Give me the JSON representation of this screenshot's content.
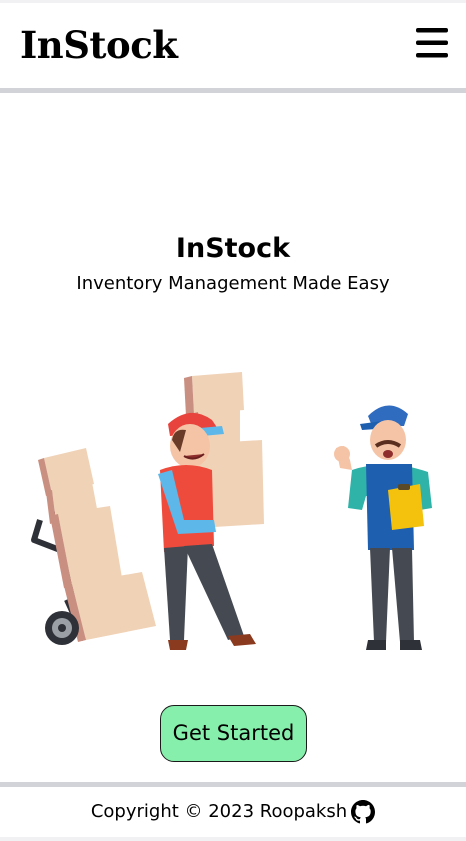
{
  "navbar": {
    "brand": "InStock",
    "menu_icon": "hamburger-menu-icon"
  },
  "hero": {
    "title": "InStock",
    "subtitle": "Inventory Management Made Easy",
    "illustration": "warehouse-workers-with-boxes"
  },
  "cta": {
    "label": "Get Started",
    "color": "#86efac"
  },
  "footer": {
    "copyright": "Copyright © 2023 Roopaksh",
    "github_icon": "github-icon"
  },
  "colors": {
    "divider": "#d2d3d8",
    "box": "#f0d2b7",
    "box_shade": "#c98f80",
    "shirt_red": "#ef4b3c",
    "shirt_blue": "#1f5fb0",
    "cap_red": "#e8433c",
    "cap_blue": "#2f6bbf"
  }
}
